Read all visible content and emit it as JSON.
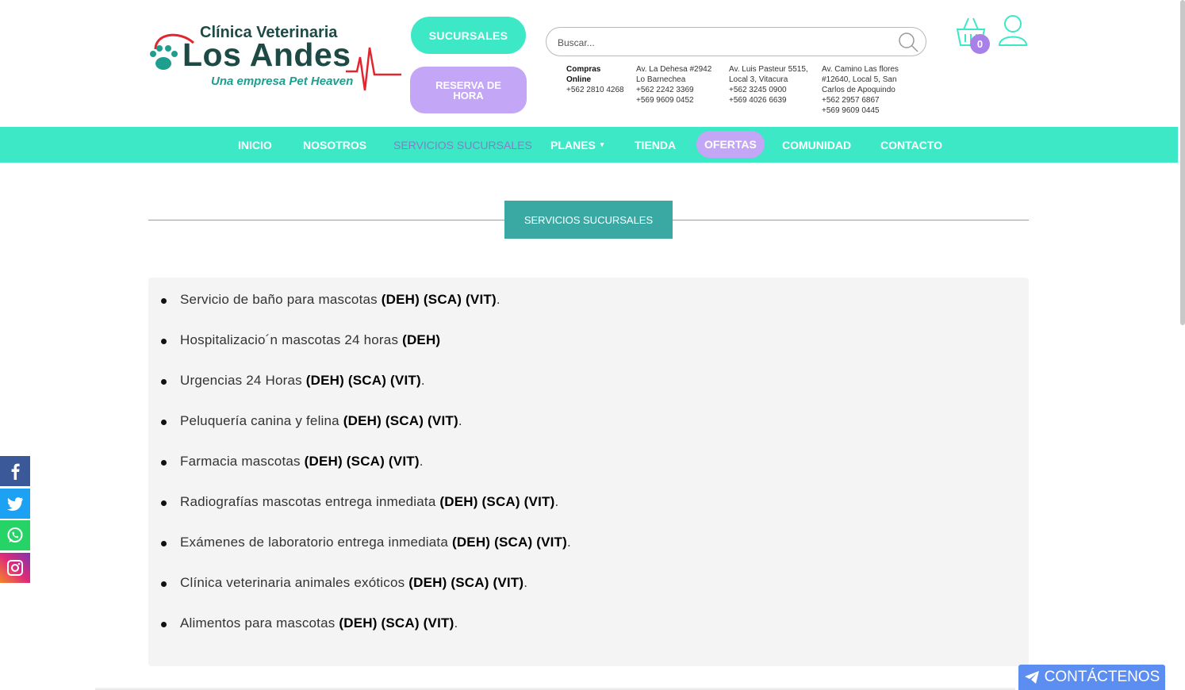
{
  "brand": {
    "line1": "Clínica Veterinaria",
    "line2": "Los Andes",
    "tagline": "Una empresa Pet Heaven"
  },
  "header": {
    "sucursales_label": "SUCURSALES",
    "reserva_label": "RESERVA DE HORA",
    "search_placeholder": "Buscar...",
    "cart_count": "0"
  },
  "contacts": [
    {
      "lines": [
        "Compras",
        "Online",
        "+562 2810 4268"
      ]
    },
    {
      "lines": [
        "Av. La Dehesa #2942",
        "Lo Barnechea",
        "+562 2242 3369",
        "+569 9609 0452"
      ]
    },
    {
      "lines": [
        "Av. Luis Pasteur 5515,",
        "Local 3, Vitacura",
        "+562 3245 0900",
        "+569 4026 6639"
      ]
    },
    {
      "lines": [
        "Av. Camino Las flores",
        "#12640, Local 5, San",
        "Carlos de Apoquindo",
        "+562 2957 6867",
        "+569 9609 0445"
      ]
    }
  ],
  "nav": {
    "items": [
      "INICIO",
      "NOSOTROS",
      "SERVICIOS SUCURSALES",
      "PLANES",
      "TIENDA",
      "OFERTAS",
      "COMUNIDAD",
      "CONTACTO"
    ],
    "active": "SERVICIOS SUCURSALES"
  },
  "section": {
    "title": "SERVICIOS SUCURSALES",
    "services": [
      {
        "text": "Servicio de baño para mascotas ",
        "tags": "(DEH) (SCA) (VIT)",
        "end": "."
      },
      {
        "text": "Hospitalizacio´n mascotas 24 horas ",
        "tags": "(DEH)",
        "end": ""
      },
      {
        "text": "Urgencias 24 Horas ",
        "tags": "(DEH) (SCA) (VIT)",
        "end": "."
      },
      {
        "text": "Peluquería canina y felina ",
        "tags": "(DEH) (SCA) (VIT)",
        "end": "."
      },
      {
        "text": "Farmacia mascotas ",
        "tags": "(DEH) (SCA) (VIT)",
        "end": "."
      },
      {
        "text": "Radiografías mascotas entrega inmediata ",
        "tags": "(DEH) (SCA) (VIT)",
        "end": "."
      },
      {
        "text": "Exámenes de laboratorio entrega inmediata ",
        "tags": "(DEH) (SCA) (VIT)",
        "end": "."
      },
      {
        "text": "Clínica veterinaria animales exóticos ",
        "tags": "(DEH) (SCA) (VIT)",
        "end": "."
      },
      {
        "text": "Alimentos para mascotas ",
        "tags": "(DEH) (SCA) (VIT)",
        "end": "."
      }
    ]
  },
  "social": [
    "facebook-icon",
    "twitter-icon",
    "whatsapp-icon",
    "instagram-icon"
  ],
  "contact_button": "CONTÁCTENOS",
  "colors": {
    "accent": "#3de8c6",
    "purple": "#c3a6f5",
    "title_bg": "#3aa9a3",
    "brand_dark": "#1d4a45",
    "contact_btn": "#5b8ef0"
  }
}
